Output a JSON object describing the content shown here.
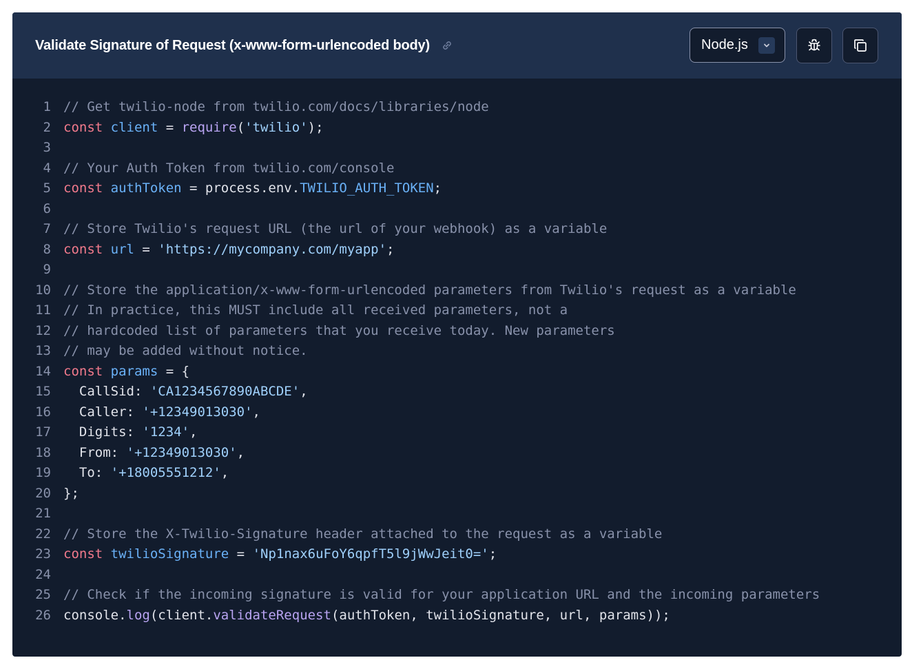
{
  "header": {
    "title": "Validate Signature of Request (x-www-form-urlencoded body)",
    "language_selected": "Node.js",
    "icons": {
      "link": "link-icon",
      "chevron": "chevron-down-icon",
      "debug": "bug-icon",
      "copy": "copy-icon"
    }
  },
  "colors": {
    "header_bg": "#1f304c",
    "code_bg": "#121c2d",
    "comment": "#8891aa",
    "keyword": "#f27a8c",
    "variable": "#6ab1f7",
    "function": "#b9a4f2",
    "string": "#9fd0fb",
    "text": "#e1e3ea"
  },
  "code": {
    "lines": [
      [
        [
          "c",
          "// Get twilio-node from twilio.com/docs/libraries/node"
        ]
      ],
      [
        [
          "k",
          "const "
        ],
        [
          "v",
          "client"
        ],
        [
          "d",
          " = "
        ],
        [
          "f",
          "require"
        ],
        [
          "d",
          "("
        ],
        [
          "s",
          "'twilio'"
        ],
        [
          "d",
          ");"
        ]
      ],
      [],
      [
        [
          "c",
          "// Your Auth Token from twilio.com/console"
        ]
      ],
      [
        [
          "k",
          "const "
        ],
        [
          "v",
          "authToken"
        ],
        [
          "d",
          " = process.env."
        ],
        [
          "v",
          "TWILIO_AUTH_TOKEN"
        ],
        [
          "d",
          ";"
        ]
      ],
      [],
      [
        [
          "c",
          "// Store Twilio's request URL (the url of your webhook) as a variable"
        ]
      ],
      [
        [
          "k",
          "const "
        ],
        [
          "v",
          "url"
        ],
        [
          "d",
          " = "
        ],
        [
          "s",
          "'https://mycompany.com/myapp'"
        ],
        [
          "d",
          ";"
        ]
      ],
      [],
      [
        [
          "c",
          "// Store the application/x-www-form-urlencoded parameters from Twilio's request as a variable"
        ]
      ],
      [
        [
          "c",
          "// In practice, this MUST include all received parameters, not a"
        ]
      ],
      [
        [
          "c",
          "// hardcoded list of parameters that you receive today. New parameters"
        ]
      ],
      [
        [
          "c",
          "// may be added without notice."
        ]
      ],
      [
        [
          "k",
          "const "
        ],
        [
          "v",
          "params"
        ],
        [
          "d",
          " = {"
        ]
      ],
      [
        [
          "d",
          "  CallSid: "
        ],
        [
          "s",
          "'CA1234567890ABCDE'"
        ],
        [
          "d",
          ","
        ]
      ],
      [
        [
          "d",
          "  Caller: "
        ],
        [
          "s",
          "'+12349013030'"
        ],
        [
          "d",
          ","
        ]
      ],
      [
        [
          "d",
          "  Digits: "
        ],
        [
          "s",
          "'1234'"
        ],
        [
          "d",
          ","
        ]
      ],
      [
        [
          "d",
          "  From: "
        ],
        [
          "s",
          "'+12349013030'"
        ],
        [
          "d",
          ","
        ]
      ],
      [
        [
          "d",
          "  To: "
        ],
        [
          "s",
          "'+18005551212'"
        ],
        [
          "d",
          ","
        ]
      ],
      [
        [
          "d",
          "};"
        ]
      ],
      [],
      [
        [
          "c",
          "// Store the X-Twilio-Signature header attached to the request as a variable"
        ]
      ],
      [
        [
          "k",
          "const "
        ],
        [
          "v",
          "twilioSignature"
        ],
        [
          "d",
          " = "
        ],
        [
          "s",
          "'Np1nax6uFoY6qpfT5l9jWwJeit0='"
        ],
        [
          "d",
          ";"
        ]
      ],
      [],
      [
        [
          "c",
          "// Check if the incoming signature is valid for your application URL and the incoming parameters"
        ]
      ],
      [
        [
          "d",
          "console."
        ],
        [
          "f",
          "log"
        ],
        [
          "d",
          "(client."
        ],
        [
          "f",
          "validateRequest"
        ],
        [
          "d",
          "(authToken, twilioSignature, url, params));"
        ]
      ]
    ]
  }
}
